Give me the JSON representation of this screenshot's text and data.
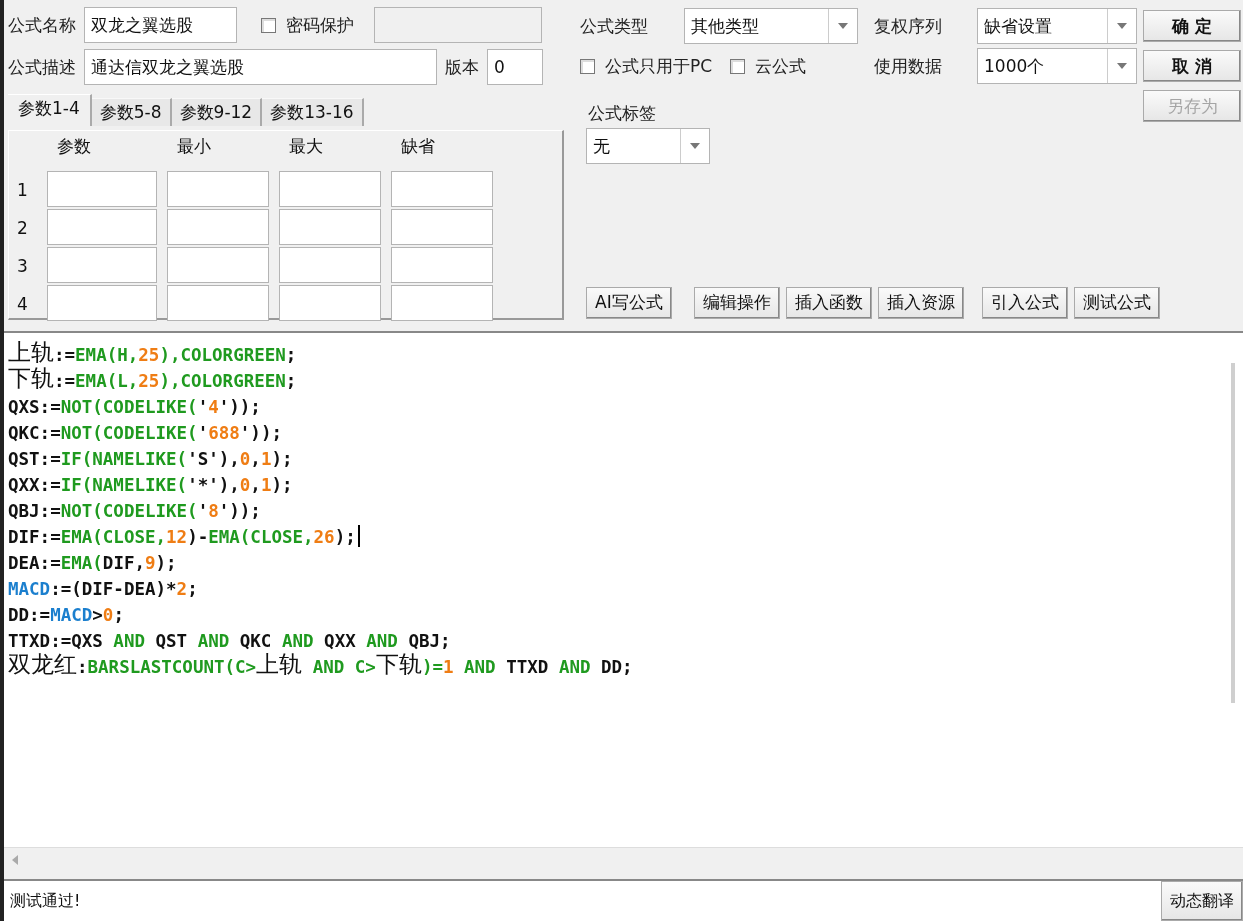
{
  "name_field": {
    "label": "公式名称",
    "value": "双龙之翼选股"
  },
  "password_protect": {
    "label": "密码保护",
    "checked": false
  },
  "description_field": {
    "label": "公式描述",
    "value": "通达信双龙之翼选股"
  },
  "version_field": {
    "label": "版本",
    "value": "0"
  },
  "param_tabs": [
    {
      "label": "参数1-4",
      "selected": true
    },
    {
      "label": "参数5-8",
      "selected": false
    },
    {
      "label": "参数9-12",
      "selected": false
    },
    {
      "label": "参数13-16",
      "selected": false
    }
  ],
  "param_table": {
    "columns": [
      "参数",
      "最小",
      "最大",
      "缺省"
    ],
    "rows": [
      "1",
      "2",
      "3",
      "4"
    ]
  },
  "type_select": {
    "label": "公式类型",
    "value": "其他类型"
  },
  "options": [
    {
      "label": "公式只用于PC",
      "checked": false
    },
    {
      "label": "云公式",
      "checked": false
    }
  ],
  "rights_select": {
    "label": "复权序列",
    "value": "缺省设置"
  },
  "data_select": {
    "label": "使用数据",
    "value": "1000个"
  },
  "tag_select": {
    "label": "公式标签",
    "value": "无"
  },
  "side_buttons": [
    {
      "label": "确 定",
      "disabled": false
    },
    {
      "label": "取 消",
      "disabled": false
    },
    {
      "label": "另存为",
      "disabled": true
    }
  ],
  "tool_buttons": [
    "AI写公式",
    "编辑操作",
    "插入函数",
    "插入资源",
    "引入公式",
    "测试公式"
  ],
  "code_lines": [
    {
      "caret": false,
      "tokens": [
        {
          "kind": "cjk",
          "text": "上轨"
        },
        {
          "kind": "text",
          "text": ":="
        },
        {
          "kind": "fn",
          "text": "EMA(H,"
        },
        {
          "kind": "num",
          "text": "25"
        },
        {
          "kind": "fn",
          "text": "),COLORGREEN"
        },
        {
          "kind": "text",
          "text": ";"
        }
      ]
    },
    {
      "caret": false,
      "tokens": [
        {
          "kind": "cjk",
          "text": "下轨"
        },
        {
          "kind": "text",
          "text": ":="
        },
        {
          "kind": "fn",
          "text": "EMA(L,"
        },
        {
          "kind": "num",
          "text": "25"
        },
        {
          "kind": "fn",
          "text": "),COLORGREEN"
        },
        {
          "kind": "text",
          "text": ";"
        }
      ]
    },
    {
      "caret": false,
      "tokens": [
        {
          "kind": "text",
          "text": "QXS:="
        },
        {
          "kind": "fn",
          "text": "NOT(CODELIKE("
        },
        {
          "kind": "text",
          "text": "'"
        },
        {
          "kind": "num",
          "text": "4"
        },
        {
          "kind": "text",
          "text": "'));"
        }
      ]
    },
    {
      "caret": false,
      "tokens": [
        {
          "kind": "text",
          "text": "QKC:="
        },
        {
          "kind": "fn",
          "text": "NOT(CODELIKE("
        },
        {
          "kind": "text",
          "text": "'"
        },
        {
          "kind": "num",
          "text": "688"
        },
        {
          "kind": "text",
          "text": "'));"
        }
      ]
    },
    {
      "caret": false,
      "tokens": [
        {
          "kind": "text",
          "text": "QST:="
        },
        {
          "kind": "fn",
          "text": "IF(NAMELIKE("
        },
        {
          "kind": "text",
          "text": "'S'),"
        },
        {
          "kind": "num",
          "text": "0"
        },
        {
          "kind": "text",
          "text": ","
        },
        {
          "kind": "num",
          "text": "1"
        },
        {
          "kind": "text",
          "text": ");"
        }
      ]
    },
    {
      "caret": false,
      "tokens": [
        {
          "kind": "text",
          "text": "QXX:="
        },
        {
          "kind": "fn",
          "text": "IF(NAMELIKE("
        },
        {
          "kind": "text",
          "text": "'*'),"
        },
        {
          "kind": "num",
          "text": "0"
        },
        {
          "kind": "text",
          "text": ","
        },
        {
          "kind": "num",
          "text": "1"
        },
        {
          "kind": "text",
          "text": ");"
        }
      ]
    },
    {
      "caret": false,
      "tokens": [
        {
          "kind": "text",
          "text": "QBJ:="
        },
        {
          "kind": "fn",
          "text": "NOT(CODELIKE("
        },
        {
          "kind": "text",
          "text": "'"
        },
        {
          "kind": "num",
          "text": "8"
        },
        {
          "kind": "text",
          "text": "'));"
        }
      ]
    },
    {
      "caret": true,
      "tokens": [
        {
          "kind": "text",
          "text": "DIF:="
        },
        {
          "kind": "fn",
          "text": "EMA(CLOSE,"
        },
        {
          "kind": "num",
          "text": "12"
        },
        {
          "kind": "text",
          "text": ")-"
        },
        {
          "kind": "fn",
          "text": "EMA(CLOSE,"
        },
        {
          "kind": "num",
          "text": "26"
        },
        {
          "kind": "text",
          "text": ");"
        }
      ]
    },
    {
      "caret": false,
      "tokens": [
        {
          "kind": "text",
          "text": "DEA:="
        },
        {
          "kind": "fn",
          "text": "EMA("
        },
        {
          "kind": "text",
          "text": "DIF,"
        },
        {
          "kind": "num",
          "text": "9"
        },
        {
          "kind": "text",
          "text": ");"
        }
      ]
    },
    {
      "caret": false,
      "tokens": [
        {
          "kind": "var",
          "text": "MACD"
        },
        {
          "kind": "text",
          "text": ":=(DIF-DEA)*"
        },
        {
          "kind": "num",
          "text": "2"
        },
        {
          "kind": "text",
          "text": ";"
        }
      ]
    },
    {
      "caret": false,
      "tokens": [
        {
          "kind": "text",
          "text": "DD:="
        },
        {
          "kind": "var",
          "text": "MACD"
        },
        {
          "kind": "text",
          "text": ">"
        },
        {
          "kind": "num",
          "text": "0"
        },
        {
          "kind": "text",
          "text": ";"
        }
      ]
    },
    {
      "caret": false,
      "tokens": [
        {
          "kind": "text",
          "text": "TTXD:=QXS "
        },
        {
          "kind": "fn",
          "text": "AND"
        },
        {
          "kind": "text",
          "text": " QST "
        },
        {
          "kind": "fn",
          "text": "AND"
        },
        {
          "kind": "text",
          "text": " QKC "
        },
        {
          "kind": "fn",
          "text": "AND"
        },
        {
          "kind": "text",
          "text": " QXX "
        },
        {
          "kind": "fn",
          "text": "AND"
        },
        {
          "kind": "text",
          "text": " QBJ;"
        }
      ]
    },
    {
      "caret": false,
      "tokens": [
        {
          "kind": "cjk",
          "text": "双龙红"
        },
        {
          "kind": "text",
          "text": ":"
        },
        {
          "kind": "fn",
          "text": "BARSLASTCOUNT(C>"
        },
        {
          "kind": "cjk",
          "text": "上轨"
        },
        {
          "kind": "fn",
          "text": " AND C>"
        },
        {
          "kind": "cjk",
          "text": "下轨"
        },
        {
          "kind": "fn",
          "text": ")="
        },
        {
          "kind": "num",
          "text": "1"
        },
        {
          "kind": "fn",
          "text": " AND "
        },
        {
          "kind": "text",
          "text": "TTXD "
        },
        {
          "kind": "fn",
          "text": "AND"
        },
        {
          "kind": "text",
          "text": " DD;"
        }
      ]
    }
  ],
  "status": {
    "message": "测试通过!",
    "button": "动态翻译"
  }
}
